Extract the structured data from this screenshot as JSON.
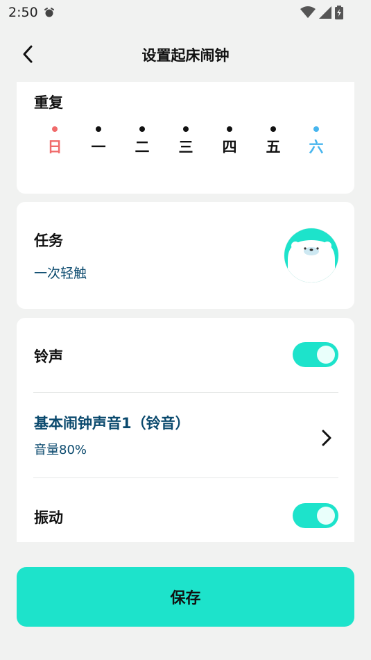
{
  "status_bar": {
    "time": "2:50"
  },
  "header": {
    "title": "设置起床闹钟"
  },
  "repeat": {
    "label": "重复",
    "days": [
      {
        "label": "日"
      },
      {
        "label": "一"
      },
      {
        "label": "二"
      },
      {
        "label": "三"
      },
      {
        "label": "四"
      },
      {
        "label": "五"
      },
      {
        "label": "六"
      }
    ]
  },
  "task": {
    "label": "任务",
    "value": "一次轻触"
  },
  "sound": {
    "ringtone_label": "铃声",
    "ringtone_enabled": true,
    "ringtone_name": "基本闹钟声音1（铃音）",
    "volume_text": "音量80%",
    "vibration_label": "振动",
    "vibration_enabled": true
  },
  "save_label": "保存",
  "colors": {
    "accent": "#1de3cb",
    "sunday": "#f06b6b",
    "saturday": "#47b5ee",
    "link_text": "#0b4a6e"
  }
}
